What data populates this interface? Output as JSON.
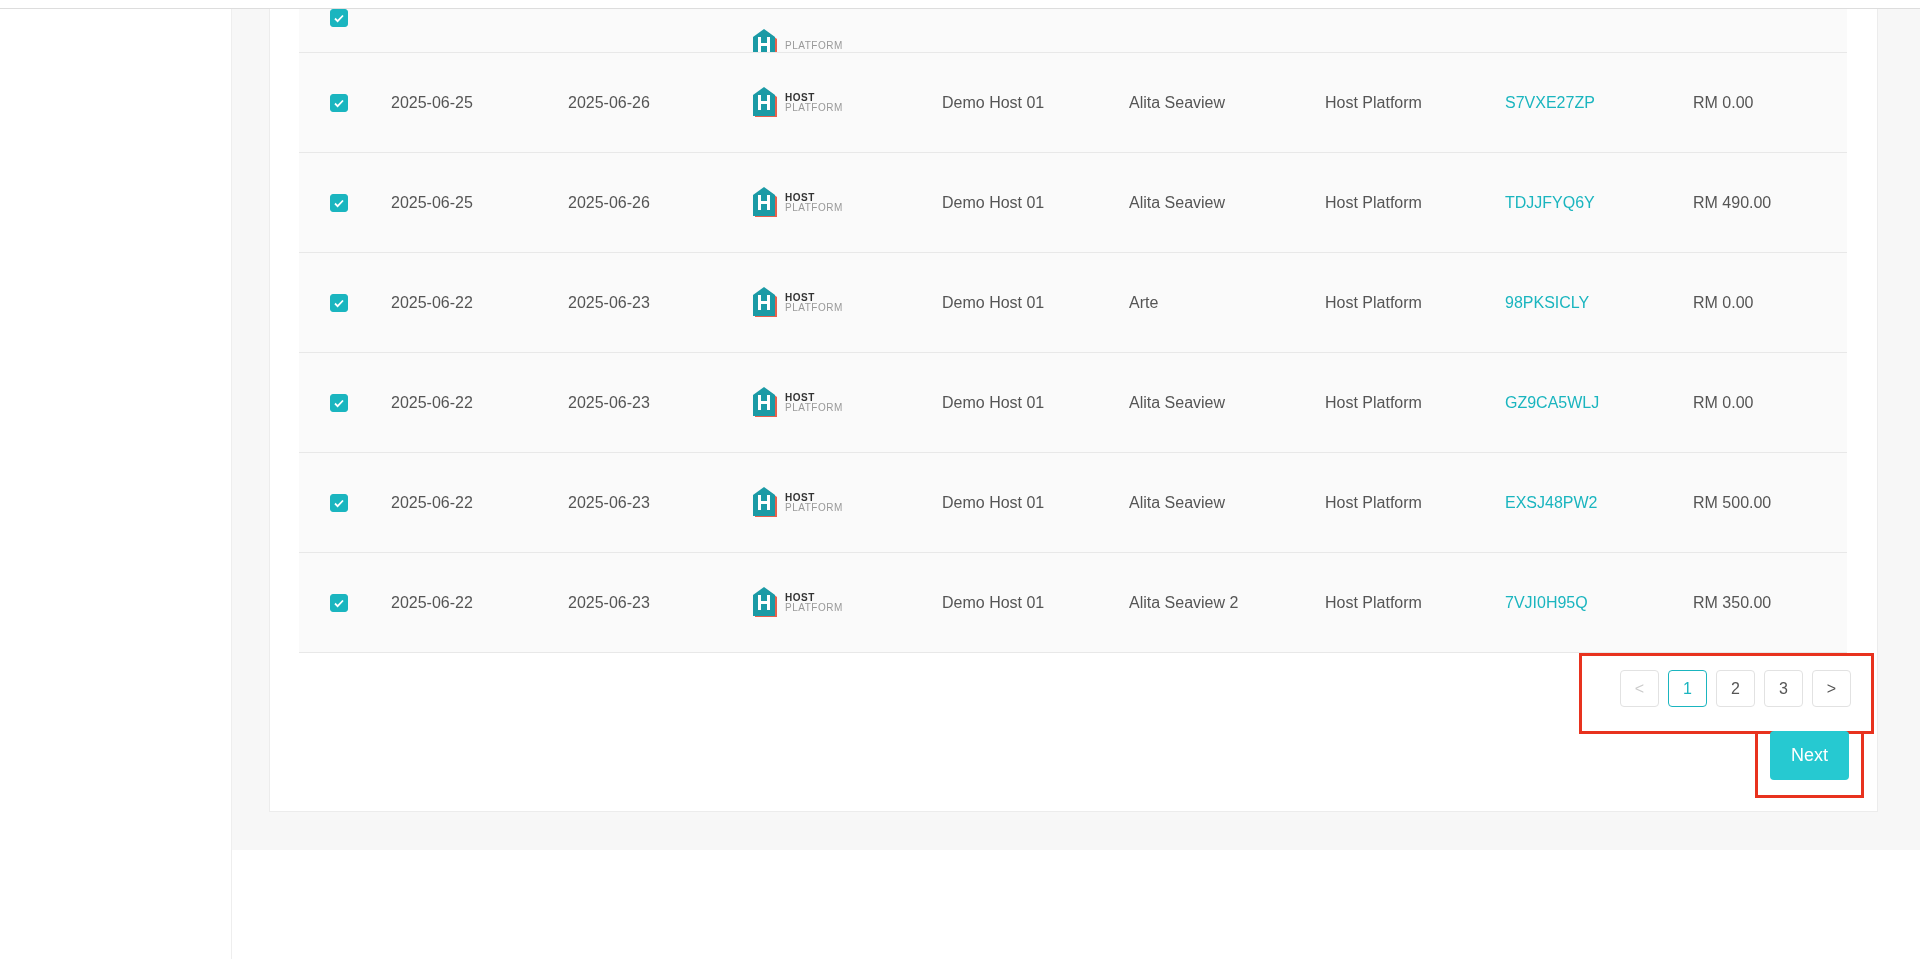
{
  "table": {
    "partial_row": {
      "checked": true,
      "logo": [
        "PLATFORM"
      ]
    },
    "rows": [
      {
        "checked": true,
        "check_in": "2025-06-25",
        "check_out": "2025-06-26",
        "logo": [
          "HOST",
          "PLATFORM"
        ],
        "host": "Demo Host 01",
        "property": "Alita Seaview",
        "channel": "Host Platform",
        "code": "S7VXE27ZP",
        "amount": "RM 0.00"
      },
      {
        "checked": true,
        "check_in": "2025-06-25",
        "check_out": "2025-06-26",
        "logo": [
          "HOST",
          "PLATFORM"
        ],
        "host": "Demo Host 01",
        "property": "Alita Seaview",
        "channel": "Host Platform",
        "code": "TDJJFYQ6Y",
        "amount": "RM 490.00"
      },
      {
        "checked": true,
        "check_in": "2025-06-22",
        "check_out": "2025-06-23",
        "logo": [
          "HOST",
          "PLATFORM"
        ],
        "host": "Demo Host 01",
        "property": "Arte",
        "channel": "Host Platform",
        "code": "98PKSICLY",
        "amount": "RM 0.00"
      },
      {
        "checked": true,
        "check_in": "2025-06-22",
        "check_out": "2025-06-23",
        "logo": [
          "HOST",
          "PLATFORM"
        ],
        "host": "Demo Host 01",
        "property": "Alita Seaview",
        "channel": "Host Platform",
        "code": "GZ9CA5WLJ",
        "amount": "RM 0.00"
      },
      {
        "checked": true,
        "check_in": "2025-06-22",
        "check_out": "2025-06-23",
        "logo": [
          "HOST",
          "PLATFORM"
        ],
        "host": "Demo Host 01",
        "property": "Alita Seaview",
        "channel": "Host Platform",
        "code": "EXSJ48PW2",
        "amount": "RM 500.00"
      },
      {
        "checked": true,
        "check_in": "2025-06-22",
        "check_out": "2025-06-23",
        "logo": [
          "HOST",
          "PLATFORM"
        ],
        "host": "Demo Host 01",
        "property": "Alita Seaview 2",
        "channel": "Host Platform",
        "code": "7VJI0H95Q",
        "amount": "RM 350.00"
      }
    ]
  },
  "pagination": {
    "highlighted": true,
    "prev": {
      "label": "<",
      "disabled": true
    },
    "pages": [
      {
        "label": "1",
        "selected": true
      },
      {
        "label": "2",
        "selected": false
      },
      {
        "label": "3",
        "selected": false
      }
    ],
    "next": {
      "label": ">",
      "disabled": false
    }
  },
  "next_button": {
    "label": "Next",
    "highlighted": true
  }
}
